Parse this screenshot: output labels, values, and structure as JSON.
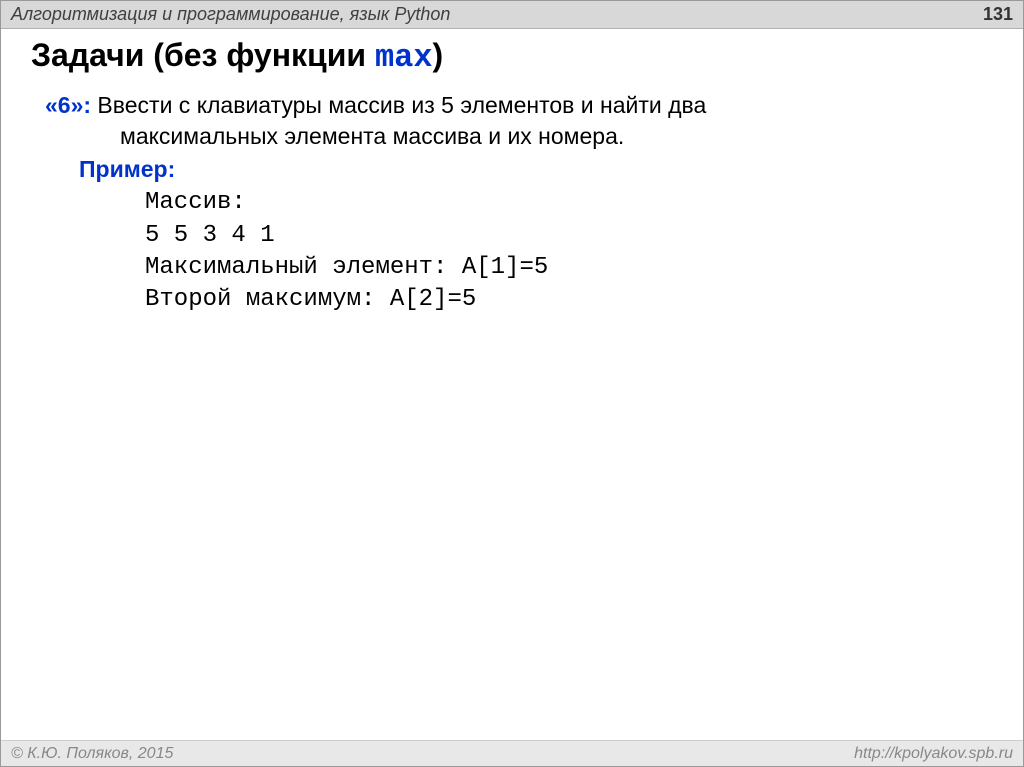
{
  "header": {
    "title": "Алгоритмизация и программирование, язык Python",
    "page_number": "131"
  },
  "title": {
    "prefix": "Задачи (без функции ",
    "func": "max",
    "suffix": ")"
  },
  "task": {
    "label": "«6»:",
    "text_first": " Ввести с клавиатуры массив из 5 элементов и найти два",
    "text_second": "максимальных элемента массива и их номера.",
    "example_label": "Пример:",
    "mono": {
      "l1": "Массив:",
      "l2": "5 5 3 4 1",
      "l3": "Максимальный элемент: A[1]=5",
      "l4": "Второй максимум: A[2]=5"
    }
  },
  "footer": {
    "copyright": "© К.Ю. Поляков, 2015",
    "url": "http://kpolyakov.spb.ru"
  }
}
